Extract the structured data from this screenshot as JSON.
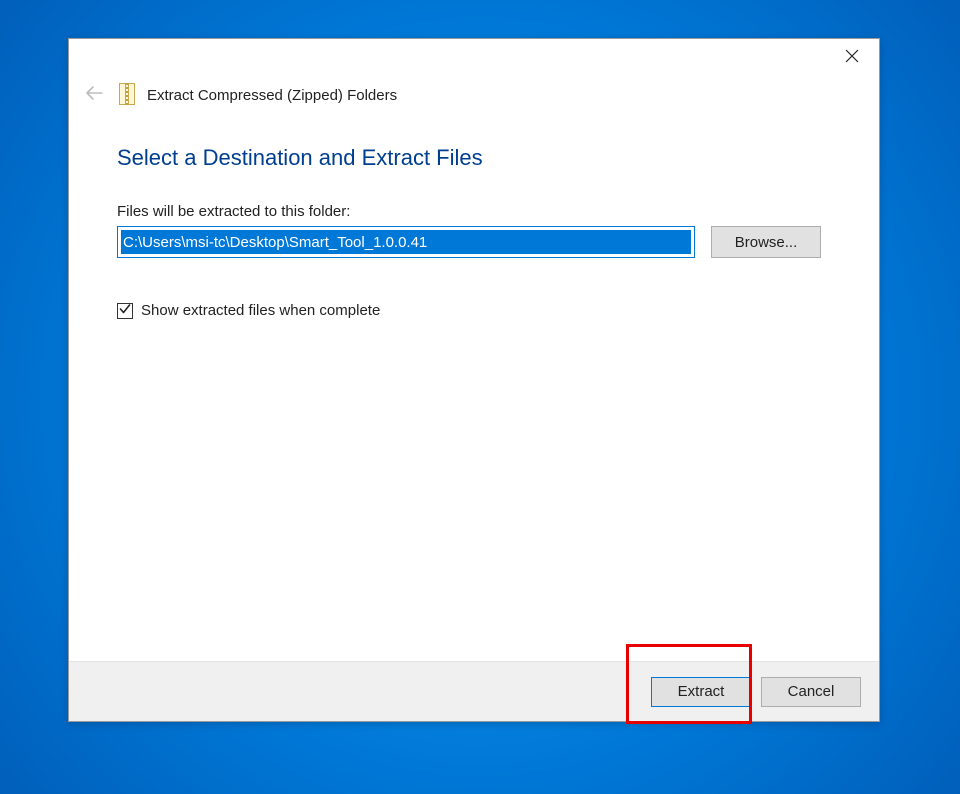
{
  "header": {
    "title": "Extract Compressed (Zipped) Folders"
  },
  "main": {
    "heading": "Select a Destination and Extract Files",
    "field_label": "Files will be extracted to this folder:",
    "path_value": "C:\\Users\\msi-tc\\Desktop\\Smart_Tool_1.0.0.41",
    "browse_label": "Browse...",
    "checkbox": {
      "checked": true,
      "label": "Show extracted files when complete"
    }
  },
  "footer": {
    "extract_label": "Extract",
    "cancel_label": "Cancel"
  }
}
